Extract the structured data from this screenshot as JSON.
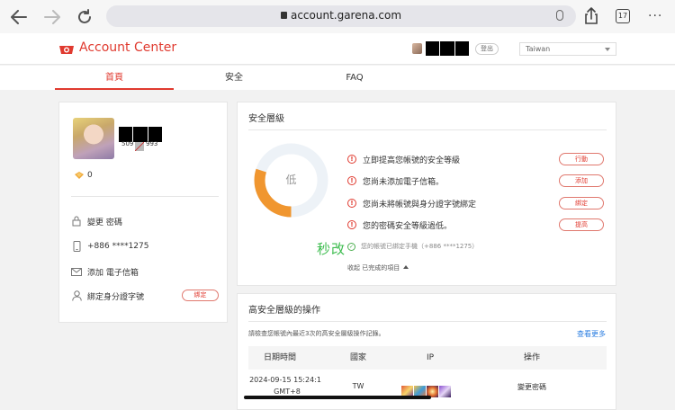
{
  "browser": {
    "url": "account.garena.com",
    "tab_count": "17",
    "more": "···"
  },
  "header": {
    "title": "Account Center",
    "logout": "登出",
    "language": "Taiwan"
  },
  "tabs": [
    {
      "label": "首頁",
      "active": true
    },
    {
      "label": "安全",
      "active": false
    },
    {
      "label": "FAQ",
      "active": false
    }
  ],
  "profile": {
    "uid_left": "509",
    "uid_right": "993",
    "shells": "0",
    "rows": [
      {
        "label": "變更 密碼",
        "icon": "lock-icon"
      },
      {
        "label": "+886 ****1275",
        "icon": "phone-icon"
      },
      {
        "label": "添加 電子信箱",
        "icon": "mail-icon"
      },
      {
        "label": "綁定身分證字號",
        "icon": "person-icon"
      }
    ],
    "bind_button": "綁定"
  },
  "security": {
    "title": "安全層級",
    "level": "低",
    "level_fraction": 0.3,
    "issues": [
      {
        "text": "立即提高您帳號的安全等級",
        "button": "行動"
      },
      {
        "text": "您尚未添加電子信箱。",
        "button": "添加"
      },
      {
        "text": "您尚未將帳號與身分證字號綁定",
        "button": "綁定"
      },
      {
        "text": "您的密碼安全等級過低。",
        "button": "提高"
      }
    ],
    "done_item": "您的帳號已綁定手機（+886 ****1275）",
    "overlay_text": "秒改",
    "collapse": "收起 已完成的項目",
    "colors": {
      "accent": "#e03a2f",
      "donut": "#f0962f",
      "donut_track": "#edf2f7",
      "green": "#3cbc4e"
    }
  },
  "history": {
    "title": "高安全層級的操作",
    "description": "請檢查您帳號內最近3次的高安全層級操作記錄。",
    "see_more": "查看更多",
    "columns": [
      "日期時間",
      "國家",
      "IP",
      "操作"
    ],
    "rows": [
      {
        "datetime": "2024-09-15 15:24:1",
        "tz": "GMT+8",
        "country": "TW",
        "action": "變更密碼"
      }
    ]
  }
}
